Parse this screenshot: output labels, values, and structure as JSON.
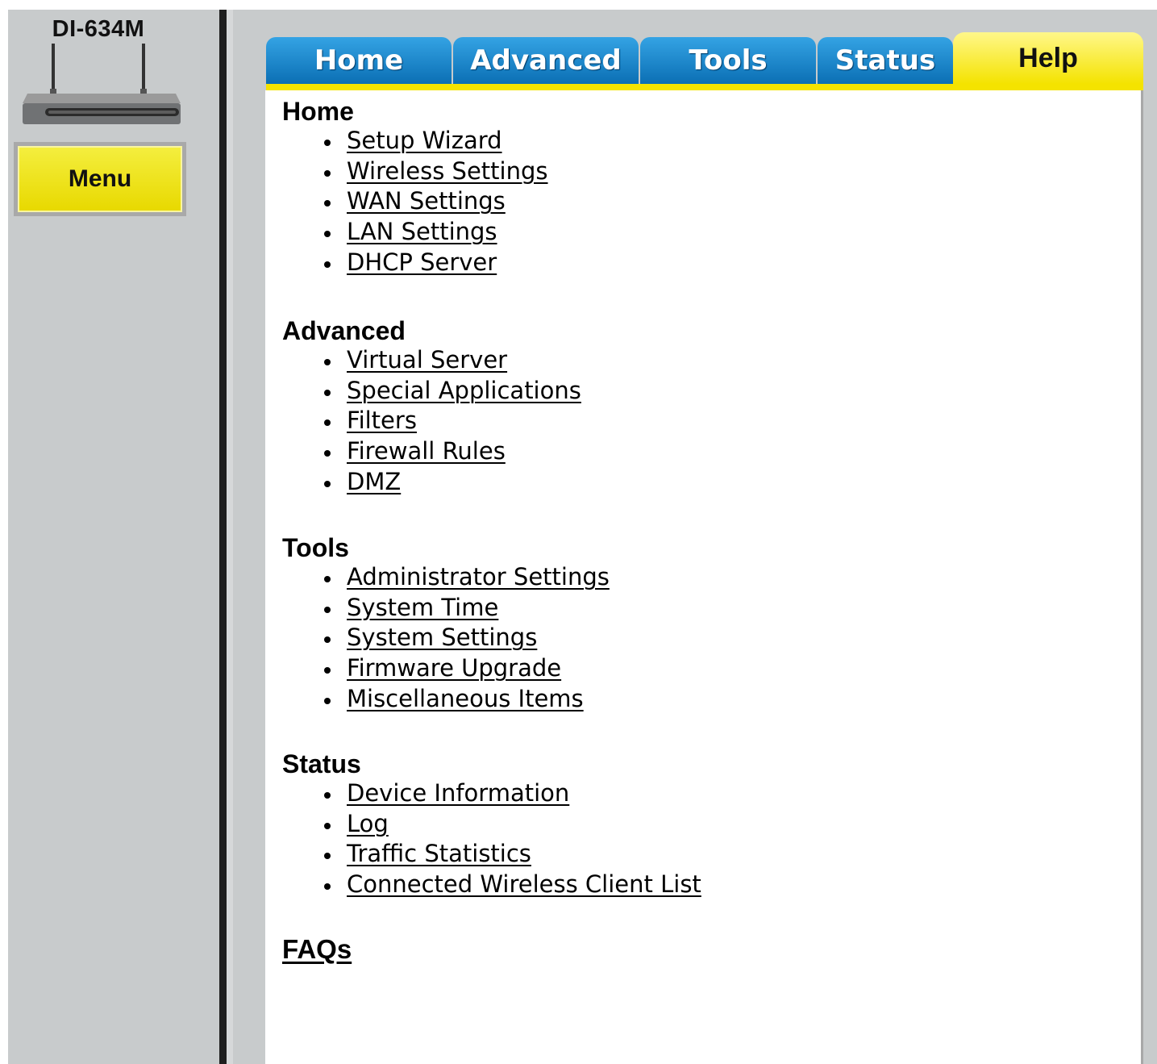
{
  "device": {
    "model": "DI-634M"
  },
  "sidebar": {
    "menu_label": "Menu"
  },
  "tabs": [
    {
      "label": "Home"
    },
    {
      "label": "Advanced"
    },
    {
      "label": "Tools"
    },
    {
      "label": "Status"
    },
    {
      "label": "Help"
    }
  ],
  "help": {
    "sections": [
      {
        "heading": "Home",
        "links": [
          "Setup Wizard",
          "Wireless Settings",
          "WAN Settings",
          "LAN Settings",
          "DHCP Server"
        ]
      },
      {
        "heading": "Advanced",
        "links": [
          "Virtual Server",
          "Special Applications",
          "Filters",
          "Firewall Rules",
          "DMZ"
        ]
      },
      {
        "heading": "Tools",
        "links": [
          "Administrator Settings",
          "System Time",
          "System Settings",
          "Firmware Upgrade",
          "Miscellaneous Items"
        ]
      },
      {
        "heading": "Status",
        "links": [
          "Device Information",
          "Log",
          "Traffic Statistics",
          "Connected Wireless Client List"
        ]
      }
    ],
    "faqs_label": "FAQs"
  },
  "colors": {
    "tab_blue": "#0b6fb4",
    "tab_active_yellow": "#f4e300",
    "sidebar_gray": "#c8cbcc"
  }
}
